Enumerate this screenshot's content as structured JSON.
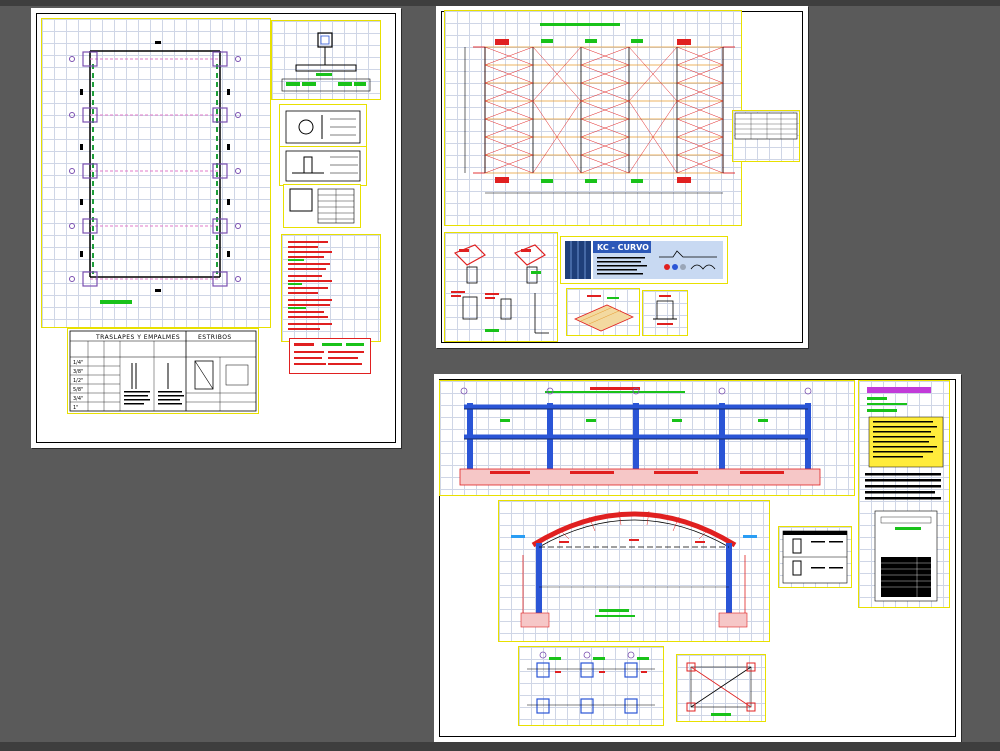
{
  "canvas": {
    "background": "#5a5a5a"
  },
  "colors": {
    "line": "#000000",
    "border_yellow": "#e8e000",
    "grid": "#cfd6e6",
    "column_purple": "#7a4fb0",
    "tie_pink": "#e07ac8",
    "beam_green": "#1e9e3a",
    "red": "#e02020",
    "green_label": "#19c219",
    "blue": "#2a55d6",
    "orange": "#e69a2c"
  },
  "sheet1": {
    "splices_table": {
      "title": "TRASLAPES Y EMPALMES",
      "stirrups_title": "ESTRIBOS",
      "rows": [
        "1/4\"",
        "3/8\"",
        "1/2\"",
        "5/8\"",
        "3/4\"",
        "1\""
      ]
    }
  },
  "sheet2": {
    "brand": {
      "title": "KC - CURVO"
    }
  },
  "sheet3": {}
}
